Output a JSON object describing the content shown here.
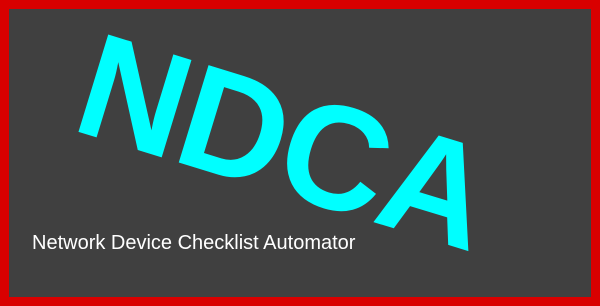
{
  "splash": {
    "logo_text": "NDCA",
    "subtitle": "Network Device Checklist Automator"
  },
  "colors": {
    "frame_border": "#d90000",
    "background": "#404040",
    "logo": "#00ffff",
    "subtitle": "#ffffff"
  }
}
